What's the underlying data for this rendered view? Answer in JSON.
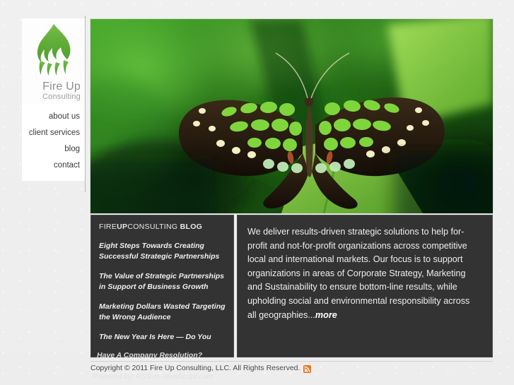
{
  "site": {
    "logo": {
      "icon": "green-flame-logo",
      "line1": "Fire Up",
      "line2": "Consulting"
    },
    "nav": [
      {
        "label": "about us"
      },
      {
        "label": "client services"
      },
      {
        "label": "blog"
      },
      {
        "label": "contact"
      }
    ]
  },
  "hero": {
    "alt": "malachite-butterfly-on-green-leaf"
  },
  "blog": {
    "head_pre": "FIRE",
    "head_bold": "UP",
    "head_mid": "CONSULTING",
    "head_label": "BLOG",
    "posts": [
      {
        "title": "Eight Steps Towards Creating Successful Strategic Partnerships"
      },
      {
        "title": "The Value of Strategic Partnerships in Support of Business Growth"
      },
      {
        "title": "Marketing Dollars Wasted Targeting the Wrong Audience"
      },
      {
        "title": "The New Year Is Here — Do You"
      }
    ],
    "clipped_line": "Have A Company Resolution?",
    "attribution": "Powered by: RSS-to-JavaScript.com"
  },
  "about": {
    "body": "We deliver results-driven strategic solutions to help for-profit and not-for-profit organizations across competitive local and international markets. Our focus is to support organizations in areas of Corporate Strategy, Marketing and Sustainability to ensure bottom-line results, while upholding social and environmental responsibility across all geographies...",
    "more_label": "more"
  },
  "footer": {
    "copyright": "Copyright © 2011 Fire Up Consulting, LLC. All Rights Reserved.",
    "rss_icon": "rss-feed-icon"
  },
  "colors": {
    "brand_green": "#5aa832",
    "panel_dark": "#333333",
    "page_bg": "#f0f0f0",
    "rss_orange": "#e8761b"
  }
}
